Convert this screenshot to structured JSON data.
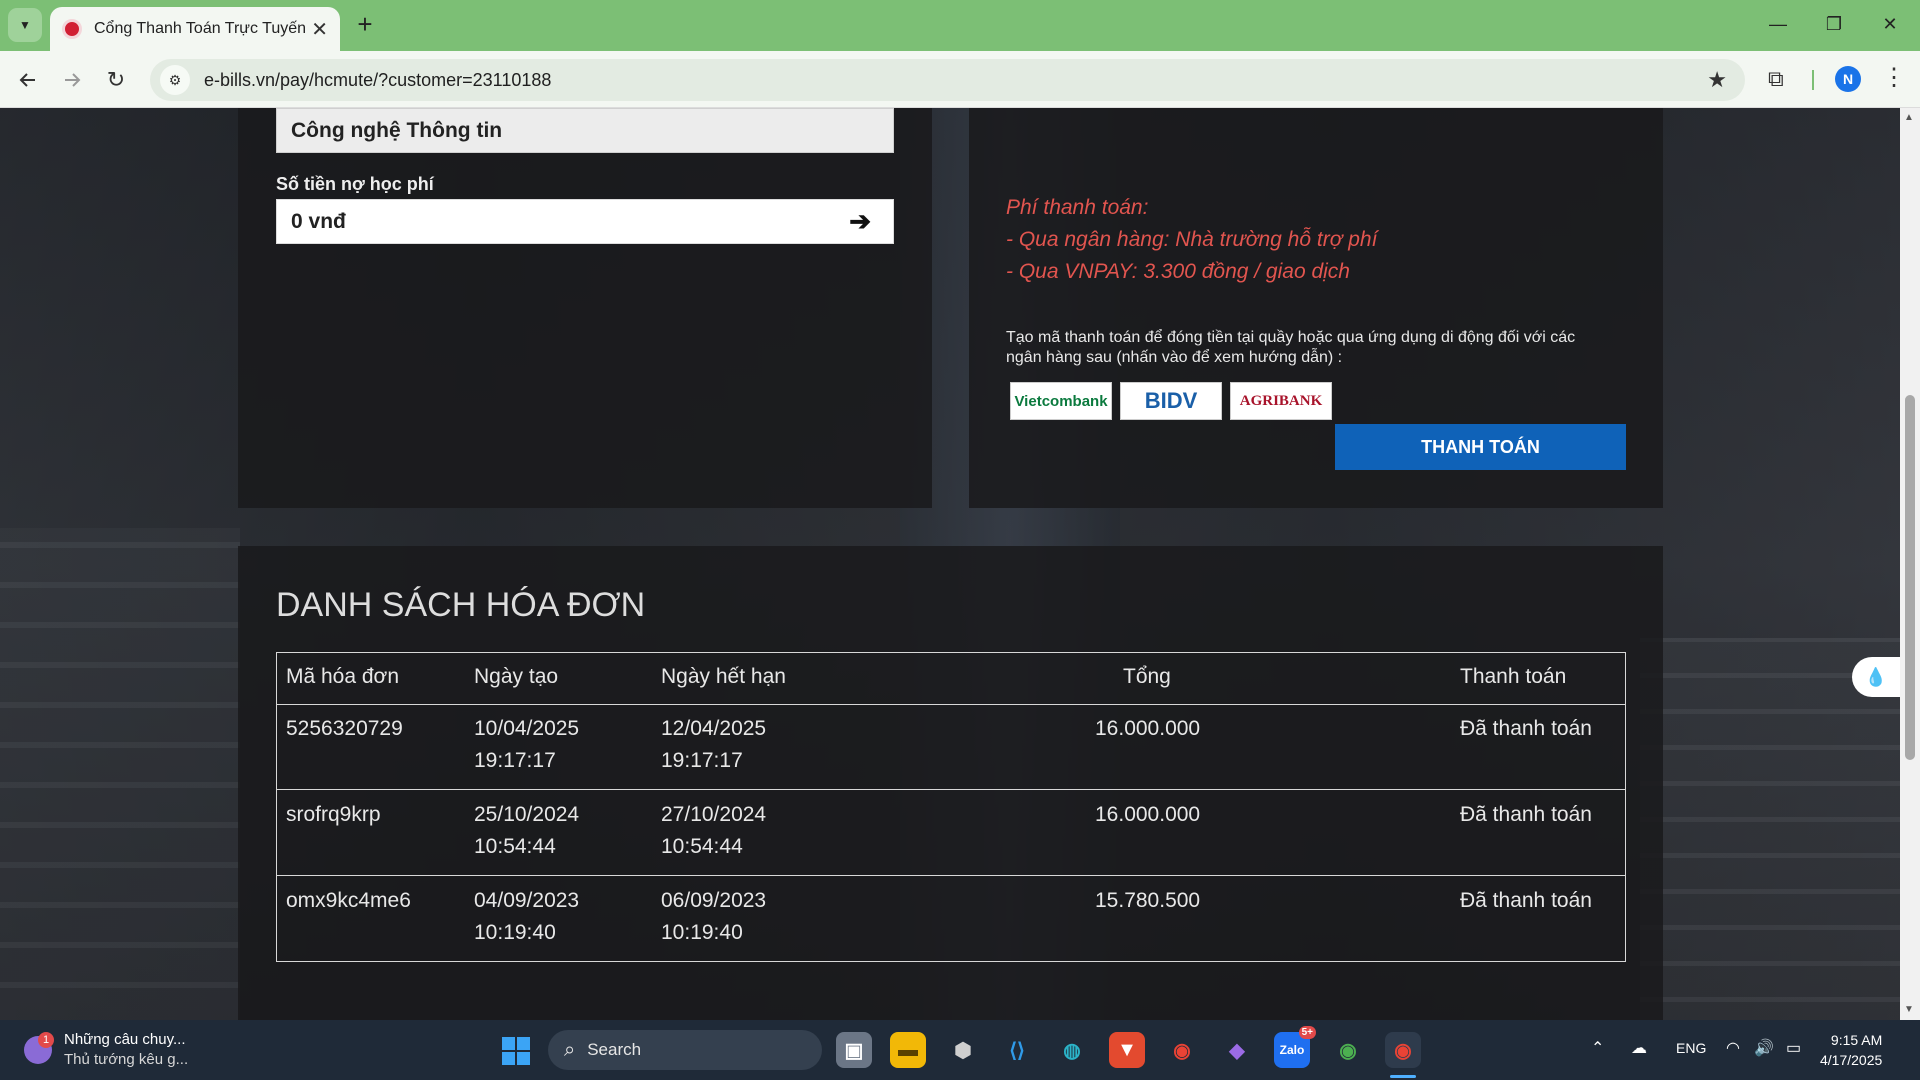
{
  "browser": {
    "tab_title": "Cổng Thanh Toán Trực Tuyến - HCMUTE",
    "url": "e-bills.vn/pay/hcmute/?customer=23110188",
    "profile_initial": "N"
  },
  "form": {
    "department_value": "Công nghệ Thông tin",
    "debt_label": "Số tiền nợ học phí",
    "debt_value": "0 vnđ"
  },
  "payment_info": {
    "fee_title": "Phí thanh toán:",
    "fee_bank": "- Qua ngân hàng: Nhà trường hỗ trợ phí",
    "fee_vnpay": "- Qua VNPAY: 3.300 đồng / giao dịch",
    "instructions": "Tạo mã thanh toán để đóng tiền tại quầy hoặc qua ứng dụng di động đối với các ngân hàng sau (nhấn vào để xem hướng dẫn) :",
    "banks": [
      "Vietcombank",
      "BIDV",
      "AGRIBANK"
    ],
    "pay_button": "THANH TOÁN"
  },
  "invoices": {
    "title": "DANH SÁCH HÓA ĐƠN",
    "headers": [
      "Mã hóa đơn",
      "Ngày tạo",
      "Ngày hết hạn",
      "Tổng",
      "Thanh toán"
    ],
    "rows": [
      {
        "id": "5256320729",
        "created_date": "10/04/2025",
        "created_time": "19:17:17",
        "due_date": "12/04/2025",
        "due_time": "19:17:17",
        "total": "16.000.000",
        "status": "Đã thanh toán"
      },
      {
        "id": "srofrq9krp",
        "created_date": "25/10/2024",
        "created_time": "10:54:44",
        "due_date": "27/10/2024",
        "due_time": "10:54:44",
        "total": "16.000.000",
        "status": "Đã thanh toán"
      },
      {
        "id": "omx9kc4me6",
        "created_date": "04/09/2023",
        "created_time": "10:19:40",
        "due_date": "06/09/2023",
        "due_time": "10:19:40",
        "total": "15.780.500",
        "status": "Đã thanh toán"
      }
    ]
  },
  "taskbar": {
    "news_badge": "1",
    "news_title": "Những câu chuy...",
    "news_subtitle": "Thủ tướng kêu g...",
    "search_placeholder": "Search",
    "zalo_badge": "5+",
    "language": "ENG",
    "time": "9:15 AM",
    "date": "4/17/2025"
  },
  "colors": {
    "accent_blue": "#0f62b8",
    "fee_red": "#e2554f",
    "tabbar_green": "#7cbf75"
  }
}
